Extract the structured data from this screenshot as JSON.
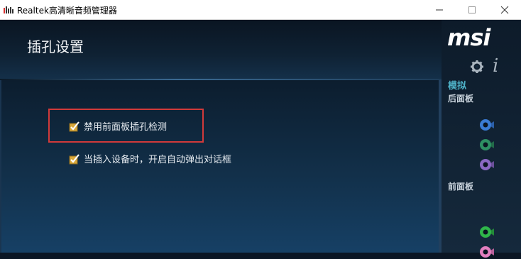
{
  "window": {
    "title": "Realtek高清晰音频管理器"
  },
  "header": {
    "title": "插孔设置"
  },
  "options": [
    {
      "label": "禁用前面板插孔检测",
      "checked": true,
      "highlighted": true
    },
    {
      "label": "当插入设备时，开启自动弹出对话框",
      "checked": true,
      "highlighted": false
    }
  ],
  "sidebar": {
    "logo": "msi",
    "tab_label": "模拟",
    "back_panel_label": "后面板",
    "front_panel_label": "前面板",
    "back_jacks": [
      {
        "name": "blue-jack",
        "color": "#3a7bd5"
      },
      {
        "name": "green-jack",
        "color": "#2e8f63"
      },
      {
        "name": "purple-jack",
        "color": "#8a68c4"
      }
    ],
    "front_jacks": [
      {
        "name": "green-jack",
        "color": "#2fb64a"
      },
      {
        "name": "pink-jack",
        "color": "#e37fbf"
      }
    ]
  },
  "colors": {
    "highlight_border": "#d23a3a",
    "accent": "#4fb3c9"
  }
}
